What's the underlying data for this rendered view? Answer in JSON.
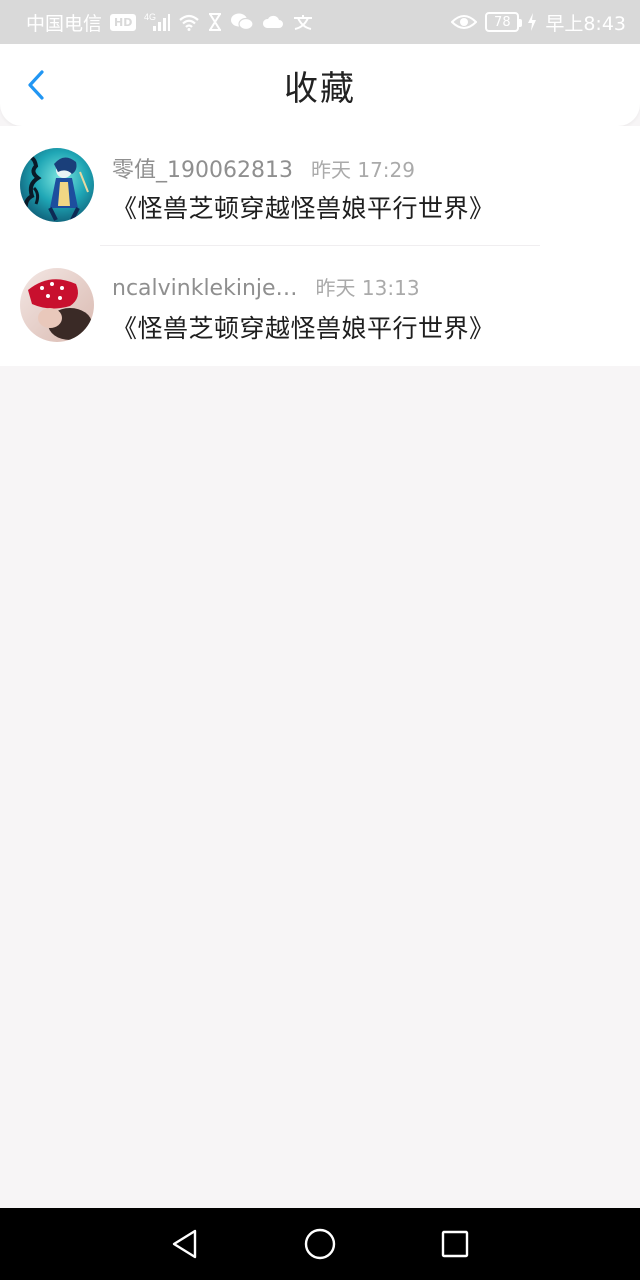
{
  "status_bar": {
    "carrier": "中国电信",
    "hd_badge": "HD",
    "network": "4G",
    "battery_level": "78",
    "time": "早上8:43",
    "icons": [
      "signal-icon",
      "wifi-icon",
      "hourglass-icon",
      "wechat-icon",
      "cloud-icon",
      "translate-icon",
      "eye-icon",
      "battery-icon",
      "charging-icon"
    ]
  },
  "header": {
    "title": "收藏",
    "back_icon": "chevron-left-icon",
    "accent_color": "#2196f3"
  },
  "favorites": [
    {
      "user": "零值_190062813",
      "time": "昨天 17:29",
      "title": "《怪兽芝顿穿越怪兽娘平行世界》",
      "avatar": "anime-character-avatar"
    },
    {
      "user": "ncalvinklekinje…",
      "time": "昨天 13:13",
      "title": "《怪兽芝顿穿越怪兽娘平行世界》",
      "avatar": "photo-avatar"
    }
  ],
  "nav_bar": {
    "icons": [
      "back-triangle-icon",
      "home-circle-icon",
      "recents-square-icon"
    ]
  }
}
